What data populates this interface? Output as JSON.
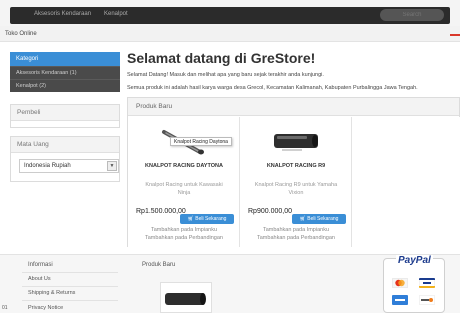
{
  "nav": {
    "items": [
      "Aksesoris Kendaraan",
      "Kenalpot"
    ],
    "search_placeholder": "Search"
  },
  "site": {
    "name": "Toko Online"
  },
  "sidebar": {
    "categories_title": "Kategori",
    "categories": [
      "Aksesoris Kendaraan (1)",
      "Kenalpot (2)"
    ],
    "buyer_title": "Pembeli",
    "currency_title": "Mata Uang",
    "currency_selected": "Indonesia Rupiah",
    "currency_arrow": "▼"
  },
  "main": {
    "welcome": "Selamat datang di GreStore!",
    "intro1": "Selamat Datang! Masuk dan melihat apa yang baru sejak terakhir anda kunjungi.",
    "intro2": "Semua produk ini adalah hasil karya warga desa Grecol, Kecamatan Kalimanah, Kabupaten Purbalingga Jawa Tengah."
  },
  "products": {
    "title": "Produk Baru",
    "items": [
      {
        "name": "KNALPOT RACING DAYTONA",
        "desc": "Knalpot Racing untuk Kawasaki Ninja",
        "price": "Rp1.500.000,00",
        "buy_label": "Beli Sekarang",
        "wishlist_label": "Tambahkan pada Impianku",
        "compare_label": "Tambahkan pada Perbandingan",
        "tooltip": "Knalpot Racing Daytona"
      },
      {
        "name": "KNALPOT RACING R9",
        "desc": "Knalpot Racing R9 untuk Yamaha Vixion",
        "price": "Rp900.000,00",
        "buy_label": "Beli Sekarang",
        "wishlist_label": "Tambahkan pada Impianku",
        "compare_label": "Tambahkan pada Perbandingan"
      }
    ]
  },
  "footer": {
    "info_title": "Informasi",
    "links": [
      "About Us",
      "Shipping & Returns",
      "Privacy Notice"
    ],
    "new_products_title": "Produk Baru",
    "paypal_label": "PayPal",
    "corner_text": "01"
  },
  "colors": {
    "accent": "#3a8ed6",
    "nav_bg": "#2b2b2b",
    "sidebar_item_bg": "#4a4a4a",
    "paypal_blue": "#1b3a8c"
  },
  "icons": [
    "exhaust-product-image",
    "paypal-logo",
    "mastercard-icon",
    "visa-icon",
    "amex-icon",
    "discover-icon",
    "cart-icon"
  ]
}
